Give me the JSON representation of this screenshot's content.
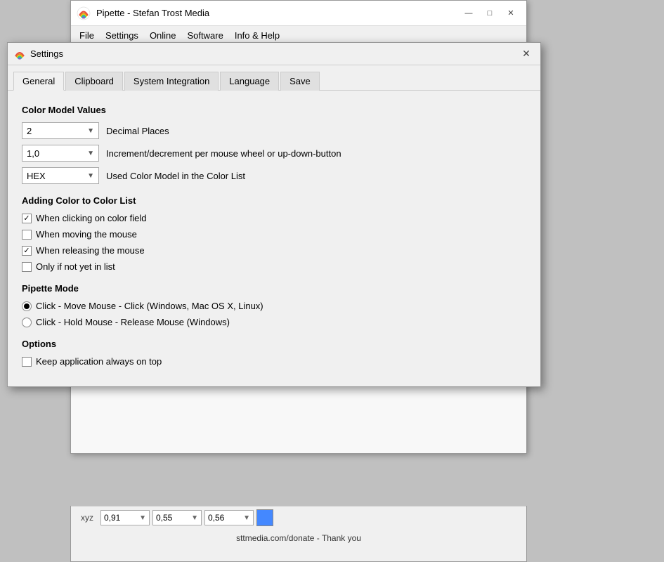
{
  "bg_app": {
    "title": "Pipette - Stefan Trost Media",
    "menu": [
      "File",
      "Settings",
      "Online",
      "Software",
      "Info & Help"
    ],
    "titlebar_controls": [
      "—",
      "□",
      "✕"
    ],
    "bottom": {
      "coord_label": "xyz",
      "coord1": "0,91",
      "coord2": "0,55",
      "coord3": "0,56",
      "statusbar": "sttmedia.com/donate - Thank you"
    }
  },
  "settings": {
    "title": "Settings",
    "close_label": "✕",
    "tabs": [
      "General",
      "Clipboard",
      "System Integration",
      "Language",
      "Save"
    ],
    "active_tab": "General",
    "sections": {
      "color_model": {
        "title": "Color Model Values",
        "rows": [
          {
            "value": "2",
            "label": "Decimal Places"
          },
          {
            "value": "1,0",
            "label": "Increment/decrement per mouse wheel or up-down-button"
          },
          {
            "value": "HEX",
            "label": "Used Color Model in the Color List"
          }
        ]
      },
      "adding_color": {
        "title": "Adding Color to Color List",
        "checkboxes": [
          {
            "label": "When clicking on color field",
            "checked": true
          },
          {
            "label": "When moving the mouse",
            "checked": false
          },
          {
            "label": "When releasing the mouse",
            "checked": true
          },
          {
            "label": "Only if not yet in list",
            "checked": false
          }
        ]
      },
      "pipette_mode": {
        "title": "Pipette Mode",
        "radios": [
          {
            "label": "Click - Move Mouse - Click (Windows, Mac OS X, Linux)",
            "selected": true
          },
          {
            "label": "Click - Hold Mouse - Release Mouse (Windows)",
            "selected": false
          }
        ]
      },
      "options": {
        "title": "Options",
        "checkboxes": [
          {
            "label": "Keep application always on top",
            "checked": false
          }
        ]
      }
    }
  }
}
